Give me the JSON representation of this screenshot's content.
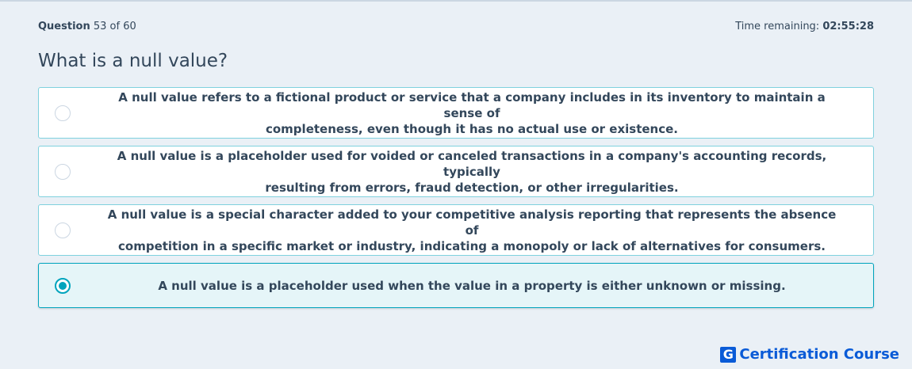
{
  "header": {
    "question_label": "Question",
    "question_number": "53",
    "question_of": "of 60",
    "time_label": "Time remaining:",
    "time_value": "02:55:28"
  },
  "question": {
    "title": "What is a null value?"
  },
  "options": [
    {
      "line1": "A null value refers to a fictional product or service that a company includes in its inventory to maintain a sense of",
      "line2": "completeness, even though it has no actual use or existence.",
      "selected": false
    },
    {
      "line1": "A null value is a placeholder used for voided or canceled transactions in a company's accounting records, typically",
      "line2": "resulting from errors, fraud detection, or other irregularities.",
      "selected": false
    },
    {
      "line1": "A null value is a special character added to your competitive analysis reporting that represents the absence of",
      "line2": "competition in a specific market or industry, indicating a monopoly or lack of alternatives for consumers.",
      "selected": false
    },
    {
      "line1": "A null value is a placeholder used when the value in a property is either unknown or missing.",
      "line2": "",
      "selected": true
    }
  ],
  "brand": {
    "logo_letter": "G",
    "name": "Certification Course",
    "color": "#0a5bd7"
  },
  "colors": {
    "accent": "#00a4bd",
    "text": "#33475b",
    "background": "#eaf0f6"
  }
}
